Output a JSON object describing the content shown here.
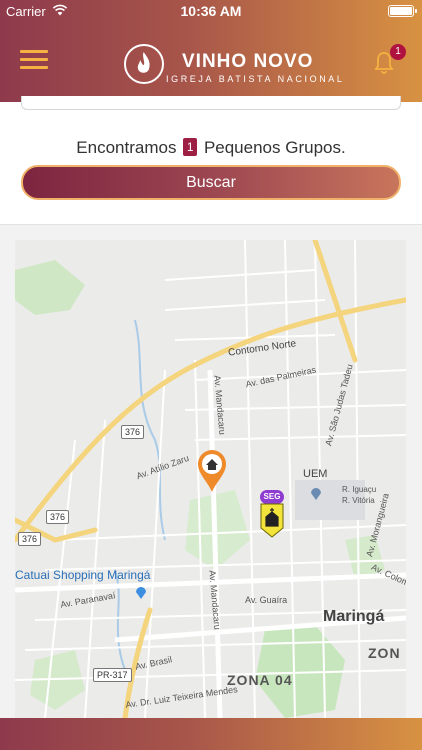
{
  "status_bar": {
    "carrier": "Carrier",
    "time": "10:36 AM"
  },
  "header": {
    "logo_title": "VINHO NOVO",
    "logo_subtitle": "IGREJA BATISTA NACIONAL",
    "notification_count": "1",
    "icons": [
      "menu-icon",
      "bell-icon"
    ]
  },
  "results": {
    "prefix": "Encontramos",
    "count": "1",
    "suffix": "Pequenos Grupos."
  },
  "search_button_label": "Buscar",
  "map": {
    "labels": {
      "contorno_norte": "Contorno Norte",
      "av_palmeiras": "Av. das Palmeiras",
      "av_sao_judas": "Av. São Judas Tadeu",
      "av_mandacaru_top": "Av. Mandacaru",
      "av_mandacaru_bottom": "Av. Mandacaru",
      "av_atilio": "Av. Atílio Zaru",
      "uem": "UEM",
      "r_iguacu": "R. Iguaçu",
      "r_vitoria": "R. Vitória",
      "av_morangueira": "Av. Morangueira",
      "av_colom": "Av. Colom",
      "catuai": "Catuai Shopping Maringá",
      "av_paranavai": "Av. Paranavaí",
      "av_guaira": "Av. Guaíra",
      "maringa": "Maringá",
      "zon": "ZON",
      "zona04": "ZONA 04",
      "av_brasil": "Av. Brasil",
      "av_dr_luiz": "Av. Dr. Luiz Teixeira Mendes"
    },
    "shields": {
      "s376_a": "376",
      "s376_b": "376",
      "s376_c": "376",
      "pr317": "PR-317"
    },
    "church_marker_label": "SEG",
    "marker_icons": [
      "home-marker-icon",
      "church-marker-icon"
    ],
    "colors": {
      "highway": "#f4d47c",
      "water": "#9fc3e7",
      "park": "#c8e6bd",
      "marker_orange": "#ef8a2b",
      "marker_yellow": "#f2e43a",
      "marker_purple": "#8e3dd0"
    }
  },
  "colors": {
    "brand_gradient_start": "#8e3a4c",
    "brand_gradient_end": "#d89242",
    "badge": "#9e1f44"
  }
}
